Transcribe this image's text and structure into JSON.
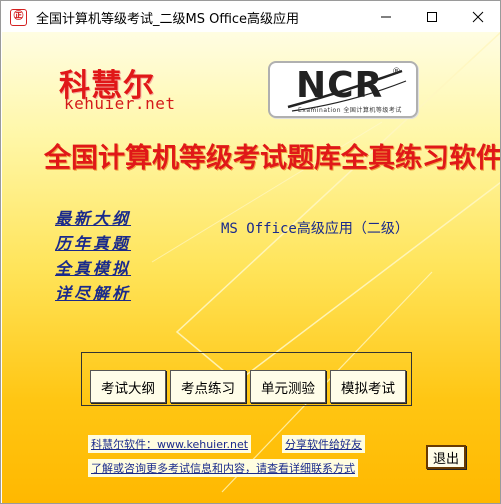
{
  "window": {
    "title": "全国计算机等级考试_二级MS Office高级应用",
    "app_icon_glyph": "㊣"
  },
  "brand": {
    "name_cn": "科慧尔",
    "url": "kehuier.net"
  },
  "logo": {
    "text": "NCR",
    "registered_mark": "®",
    "subtext": "Examination 全国计算机等级考试"
  },
  "main_title": "全国计算机等级考试题库全真练习软件",
  "features": [
    "最新大纲",
    "历年真题",
    "全真模拟",
    "详尽解析"
  ],
  "subject": "MS Office高级应用（二级）",
  "buttons": {
    "syllabus": "考试大纲",
    "practice": "考点练习",
    "unit_test": "单元测验",
    "mock_exam": "模拟考试",
    "exit": "退出"
  },
  "footer": {
    "software_line": "科慧尔软件：www.kehuier.net",
    "share": "分享软件给好友",
    "info_line": "了解或咨询更多考试信息和内容，请查看详细联系方式"
  },
  "colors": {
    "brand_red": "#e01818",
    "link_blue": "#1a2a8c",
    "bg_top": "#fffde2",
    "bg_bottom": "#ffb800"
  }
}
